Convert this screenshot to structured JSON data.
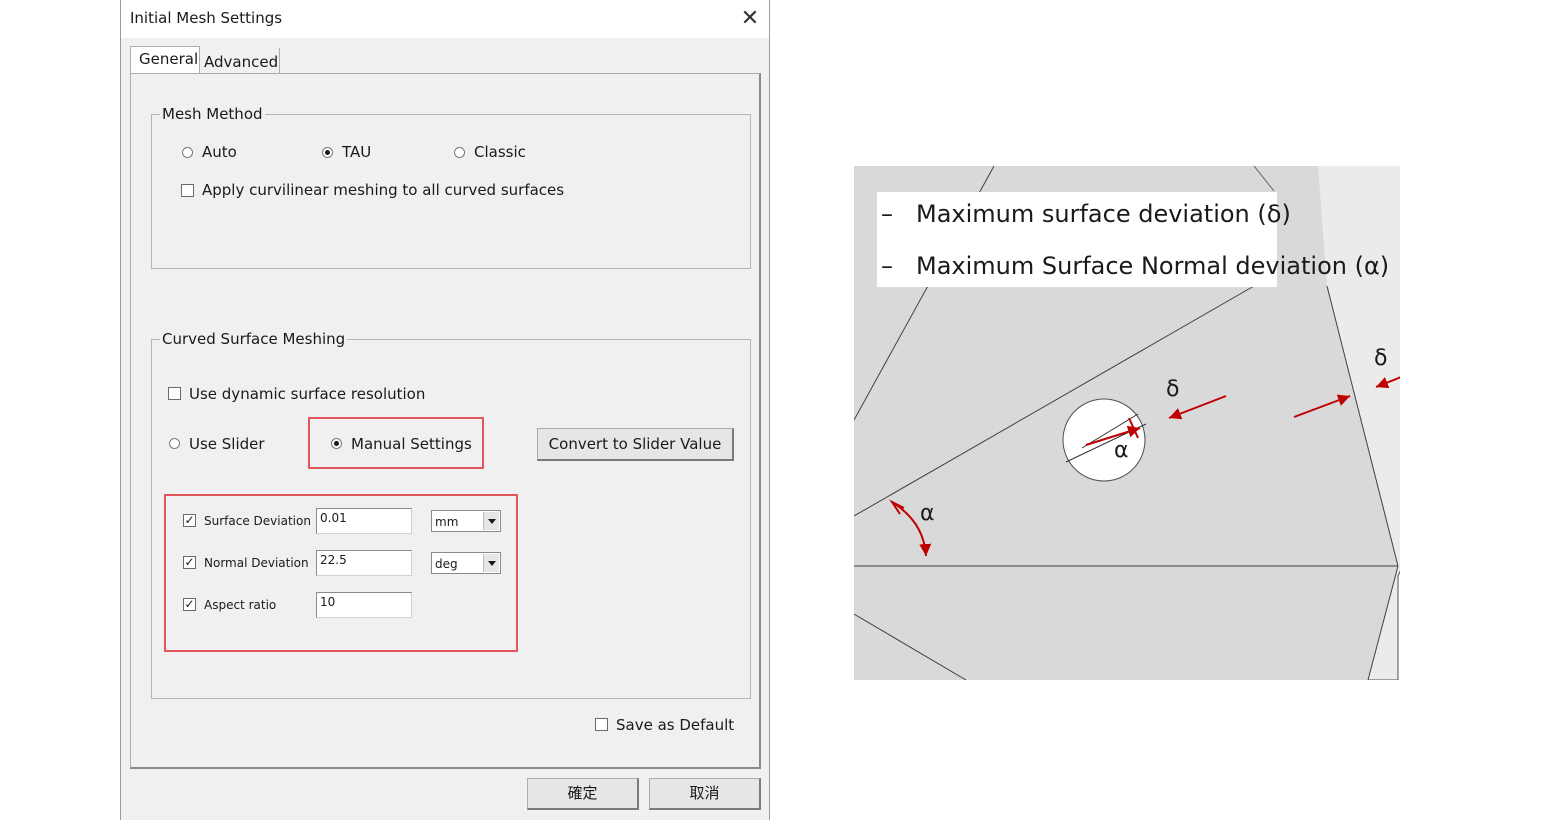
{
  "dialog": {
    "title": "Initial Mesh Settings",
    "close_glyph": "✕",
    "tabs": [
      {
        "label": "General"
      },
      {
        "label": "Advanced"
      }
    ],
    "mesh_method": {
      "group_label": "Mesh Method",
      "options": [
        {
          "label": "Auto"
        },
        {
          "label": "TAU"
        },
        {
          "label": "Classic"
        }
      ],
      "selected": "TAU",
      "curvilinear_label": "Apply curvilinear meshing to all curved surfaces"
    },
    "curved_surface": {
      "group_label": "Curved Surface Meshing",
      "dynamic_label": "Use dynamic surface resolution",
      "use_slider_label": "Use Slider",
      "manual_label": "Manual Settings",
      "convert_button": "Convert to Slider Value",
      "fields": [
        {
          "label": "Surface Deviation",
          "value": "0.01",
          "unit": "mm"
        },
        {
          "label": "Normal Deviation",
          "value": "22.5",
          "unit": "deg"
        },
        {
          "label": "Aspect ratio",
          "value": "10"
        }
      ]
    },
    "save_default_label": "Save as Default",
    "ok_button": "確定",
    "cancel_button": "取消"
  },
  "diagram": {
    "legend": [
      {
        "dash": "–",
        "text": "Maximum surface deviation (δ)"
      },
      {
        "dash": "–",
        "text": "Maximum Surface Normal deviation (α)"
      }
    ],
    "labels": {
      "delta": "δ",
      "alpha": "α"
    },
    "colors": {
      "face": "#d9d9d9",
      "outer": "#ebebeb",
      "arrow": "#c00000",
      "edge": "#404040"
    }
  }
}
